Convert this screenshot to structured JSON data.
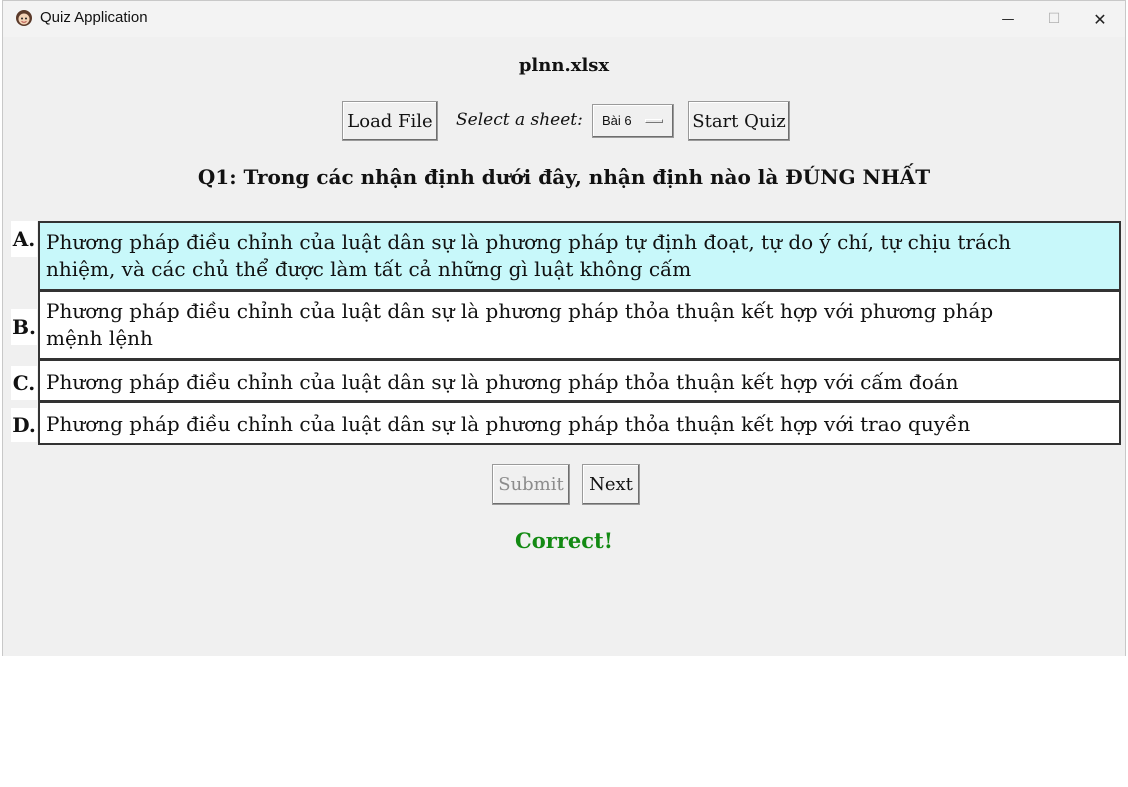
{
  "window": {
    "title": "Quiz Application",
    "minimize_glyph": "—",
    "maximize_glyph": "☐",
    "close_glyph": "✕"
  },
  "file_name": "plnn.xlsx",
  "toolbar": {
    "load_label": "Load File",
    "sheet_label": "Select a sheet:",
    "sheet_value": "Bài 6",
    "start_label": "Start Quiz"
  },
  "question": "Q1: Trong các nhận định dưới đây, nhận định nào là ĐÚNG NHẤT",
  "options": [
    {
      "letter": "A.",
      "line1": "Phương pháp điều chỉnh của luật dân sự là phương pháp tự định đoạt, tự do ý chí, tự chịu trách",
      "line2": "nhiệm, và các chủ thể được làm tất cả những gì luật không cấm"
    },
    {
      "letter": "B.",
      "line1": "Phương pháp điều chỉnh của luật dân sự là phương pháp thỏa thuận kết hợp với phương pháp",
      "line2": "mệnh lệnh"
    },
    {
      "letter": "C.",
      "line1": "Phương pháp điều chỉnh của luật dân sự là phương pháp thỏa thuận kết hợp với cấm đoán"
    },
    {
      "letter": "D.",
      "line1": "Phương pháp điều chỉnh của luật dân sự là phương pháp thỏa thuận kết hợp với trao quyền"
    }
  ],
  "actions": {
    "submit_label": "Submit",
    "next_label": "Next"
  },
  "result": "Correct!",
  "colors": {
    "selected_option": "#c8f8fa",
    "result_text": "#138a13"
  }
}
